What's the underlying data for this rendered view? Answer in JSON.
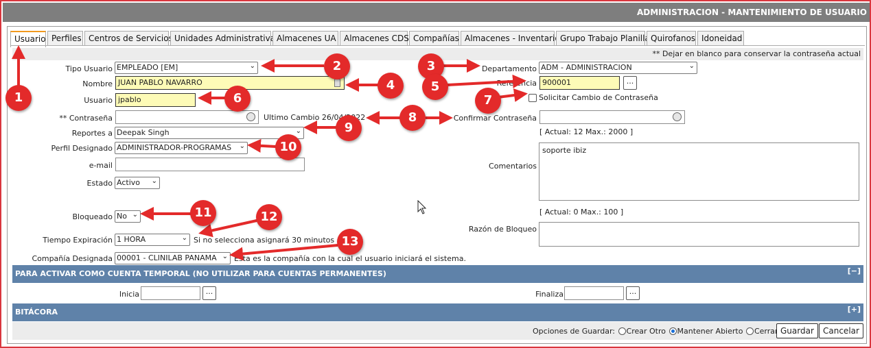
{
  "title": "ADMINISTRACION - MANTENIMIENTO DE USUARIO",
  "tabs": [
    "Usuario",
    "Perfiles",
    "Centros de Servicios",
    "Unidades Administrativas",
    "Almacenes UA",
    "Almacenes CDS",
    "Compañías",
    "Almacenes - Inventario",
    "Grupo Trabajo Planilla",
    "Quirofanos",
    "Idoneidad"
  ],
  "password_note": "** Dejar en blanco para conservar la contraseña actual",
  "form": {
    "tipo_usuario": {
      "label": "Tipo Usuario",
      "value": "EMPLEADO [EM]"
    },
    "nombre": {
      "label": "Nombre",
      "value": "JUAN PABLO NAVARRO"
    },
    "usuario": {
      "label": "Usuario",
      "value": "jpablo"
    },
    "contrasena": {
      "label": "** Contraseña",
      "value": ""
    },
    "ultimo_cambio": "Ultimo Cambio 26/04/2022",
    "reportes_a": {
      "label": "Reportes a",
      "value": "Deepak Singh"
    },
    "perfil": {
      "label": "Perfil Designado",
      "value": "ADMINISTRADOR-PROGRAMAS"
    },
    "email": {
      "label": "e-mail",
      "value": ""
    },
    "estado": {
      "label": "Estado",
      "value": "Activo"
    },
    "bloqueado": {
      "label": "Bloqueado",
      "value": "No"
    },
    "tiempo_expiracion": {
      "label": "Tiempo Expiración",
      "value": "1 HORA",
      "hint": "Si no selecciona asignará 30 minutos"
    },
    "compania": {
      "label": "Compañía Designada",
      "value": "00001 - CLINILAB PANAMA",
      "hint": "Esta es la compañía con la cual el usuario iniciará el sistema."
    },
    "departamento": {
      "label": "Departamento",
      "value": "ADM - ADMINISTRACION"
    },
    "referencia": {
      "label": "Referencia",
      "value": "900001"
    },
    "solicitar_cambio": "Solicitar Cambio de Contraseña",
    "confirmar": {
      "label": "Confirmar Contraseña",
      "value": ""
    },
    "conf_counter": "[ Actual: 12    Max.: 2000 ]",
    "comentarios": {
      "label": "Comentarios",
      "value": "soporte ibiz"
    },
    "com_counter": "[ Actual: 0    Max.: 100 ]",
    "razon_bloqueo": {
      "label": "Razón de Bloqueo",
      "value": ""
    }
  },
  "temp_section": {
    "title": "PARA ACTIVAR COMO CUENTA TEMPORAL (NO UTILIZAR PARA CUENTAS PERMANENTES)",
    "toggle": "[−]",
    "inicia": "Inicia",
    "finaliza": "Finaliza"
  },
  "bitacora_section": {
    "title": "BITÁCORA",
    "toggle": "[+]"
  },
  "save": {
    "label": "Opciones de Guardar:",
    "options": [
      "Crear Otro",
      "Mantener Abierto",
      "Cerrar"
    ],
    "selected": "Mantener Abierto",
    "guardar": "Guardar",
    "cancelar": "Cancelar"
  },
  "dots": "...",
  "markers": [
    "1",
    "2",
    "3",
    "4",
    "5",
    "6",
    "7",
    "8",
    "9",
    "10",
    "11",
    "12",
    "13"
  ],
  "colors": {
    "marker": "#e32a2a",
    "section": "#5f82a9",
    "title_bar": "#7e7e7e",
    "highlight": "#fdfbb7"
  }
}
